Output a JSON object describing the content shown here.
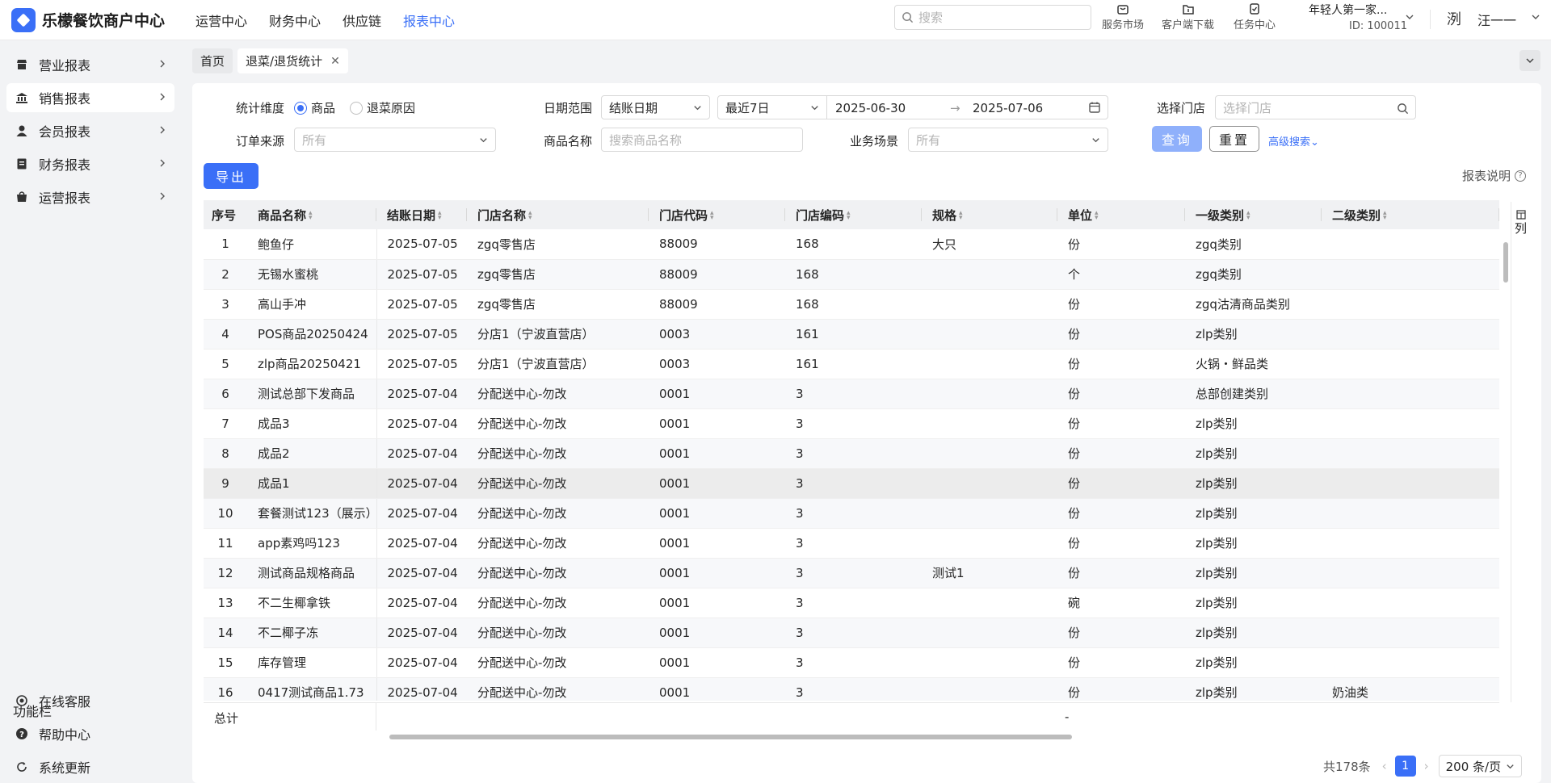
{
  "app": {
    "title": "乐檬餐饮商户中心",
    "nav": [
      "运营中心",
      "财务中心",
      "供应链",
      "报表中心"
    ],
    "nav_active": 3,
    "search_placeholder": "搜索",
    "tools": [
      "服务市场",
      "客户端下载",
      "任务中心"
    ],
    "tenant_name": "年轻人第一家...",
    "tenant_id": "ID: 100011",
    "avatar_char": "洌",
    "username": "汪一一"
  },
  "sidebar": {
    "items": [
      {
        "label": "营业报表",
        "icon": "store-icon"
      },
      {
        "label": "销售报表",
        "icon": "bank-icon"
      },
      {
        "label": "会员报表",
        "icon": "user-icon"
      },
      {
        "label": "财务报表",
        "icon": "ledger-icon"
      },
      {
        "label": "运营报表",
        "icon": "bag-icon"
      }
    ],
    "active_index": 1,
    "func_title": "功能栏",
    "func_items": [
      {
        "label": "在线客服",
        "icon": "headset-icon"
      },
      {
        "label": "帮助中心",
        "icon": "help-icon"
      },
      {
        "label": "系统更新",
        "icon": "refresh-icon"
      }
    ]
  },
  "tabs": [
    {
      "label": "首页",
      "closable": false
    },
    {
      "label": "退菜/退货统计",
      "closable": true
    }
  ],
  "filters": {
    "dimension_label": "统计维度",
    "dimension_options": [
      "商品",
      "退菜原因"
    ],
    "dimension_selected": 0,
    "date_label": "日期范围",
    "date_type": "结账日期",
    "date_preset": "最近7日",
    "date_start": "2025-06-30",
    "date_end": "2025-07-06",
    "store_label": "选择门店",
    "store_placeholder": "选择门店",
    "source_label": "订单来源",
    "source_value": "所有",
    "goods_label": "商品名称",
    "goods_placeholder": "搜索商品名称",
    "scene_label": "业务场景",
    "scene_value": "所有",
    "query_label": "查询",
    "reset_label": "重置",
    "advanced_label": "高级搜索"
  },
  "export_label": "导出",
  "report_note": "报表说明",
  "table": {
    "columns": [
      "序号",
      "商品名称",
      "结账日期",
      "门店名称",
      "门店代码",
      "门店编码",
      "规格",
      "单位",
      "一级类别",
      "二级类别"
    ],
    "rows": [
      [
        "1",
        "鲍鱼仔",
        "2025-07-05",
        "zgq零售店",
        "88009",
        "168",
        "大只",
        "份",
        "zgq类别",
        ""
      ],
      [
        "2",
        "无锡水蜜桃",
        "2025-07-05",
        "zgq零售店",
        "88009",
        "168",
        "",
        "个",
        "zgq类别",
        ""
      ],
      [
        "3",
        "高山手冲",
        "2025-07-05",
        "zgq零售店",
        "88009",
        "168",
        "",
        "份",
        "zgq沽清商品类别",
        ""
      ],
      [
        "4",
        "POS商品20250424",
        "2025-07-05",
        "分店1（宁波直营店）",
        "0003",
        "161",
        "",
        "份",
        "zlp类别",
        ""
      ],
      [
        "5",
        "zlp商品20250421",
        "2025-07-05",
        "分店1（宁波直营店）",
        "0003",
        "161",
        "",
        "份",
        "火锅・鲜品类",
        ""
      ],
      [
        "6",
        "测试总部下发商品",
        "2025-07-04",
        "分配送中心-勿改",
        "0001",
        "3",
        "",
        "份",
        "总部创建类别",
        ""
      ],
      [
        "7",
        "成品3",
        "2025-07-04",
        "分配送中心-勿改",
        "0001",
        "3",
        "",
        "份",
        "zlp类别",
        ""
      ],
      [
        "8",
        "成品2",
        "2025-07-04",
        "分配送中心-勿改",
        "0001",
        "3",
        "",
        "份",
        "zlp类别",
        ""
      ],
      [
        "9",
        "成品1",
        "2025-07-04",
        "分配送中心-勿改",
        "0001",
        "3",
        "",
        "份",
        "zlp类别",
        ""
      ],
      [
        "10",
        "套餐测试123（展示）",
        "2025-07-04",
        "分配送中心-勿改",
        "0001",
        "3",
        "",
        "份",
        "zlp类别",
        ""
      ],
      [
        "11",
        "app素鸡吗123",
        "2025-07-04",
        "分配送中心-勿改",
        "0001",
        "3",
        "",
        "份",
        "zlp类别",
        ""
      ],
      [
        "12",
        "测试商品规格商品",
        "2025-07-04",
        "分配送中心-勿改",
        "0001",
        "3",
        "测试1",
        "份",
        "zlp类别",
        ""
      ],
      [
        "13",
        "不二生椰拿铁",
        "2025-07-04",
        "分配送中心-勿改",
        "0001",
        "3",
        "",
        "碗",
        "zlp类别",
        ""
      ],
      [
        "14",
        "不二椰子冻",
        "2025-07-04",
        "分配送中心-勿改",
        "0001",
        "3",
        "",
        "份",
        "zlp类别",
        ""
      ],
      [
        "15",
        "库存管理",
        "2025-07-04",
        "分配送中心-勿改",
        "0001",
        "3",
        "",
        "份",
        "zlp类别",
        ""
      ],
      [
        "16",
        "0417测试商品1.73",
        "2025-07-04",
        "分配送中心-勿改",
        "0001",
        "3",
        "",
        "份",
        "zlp类别",
        "奶油类"
      ]
    ],
    "highlight_row": 8,
    "summary_label": "总计",
    "summary_unit": "-",
    "column_settings": "列"
  },
  "pagination": {
    "total": "共178条",
    "current": "1",
    "page_size": "200 条/页"
  }
}
